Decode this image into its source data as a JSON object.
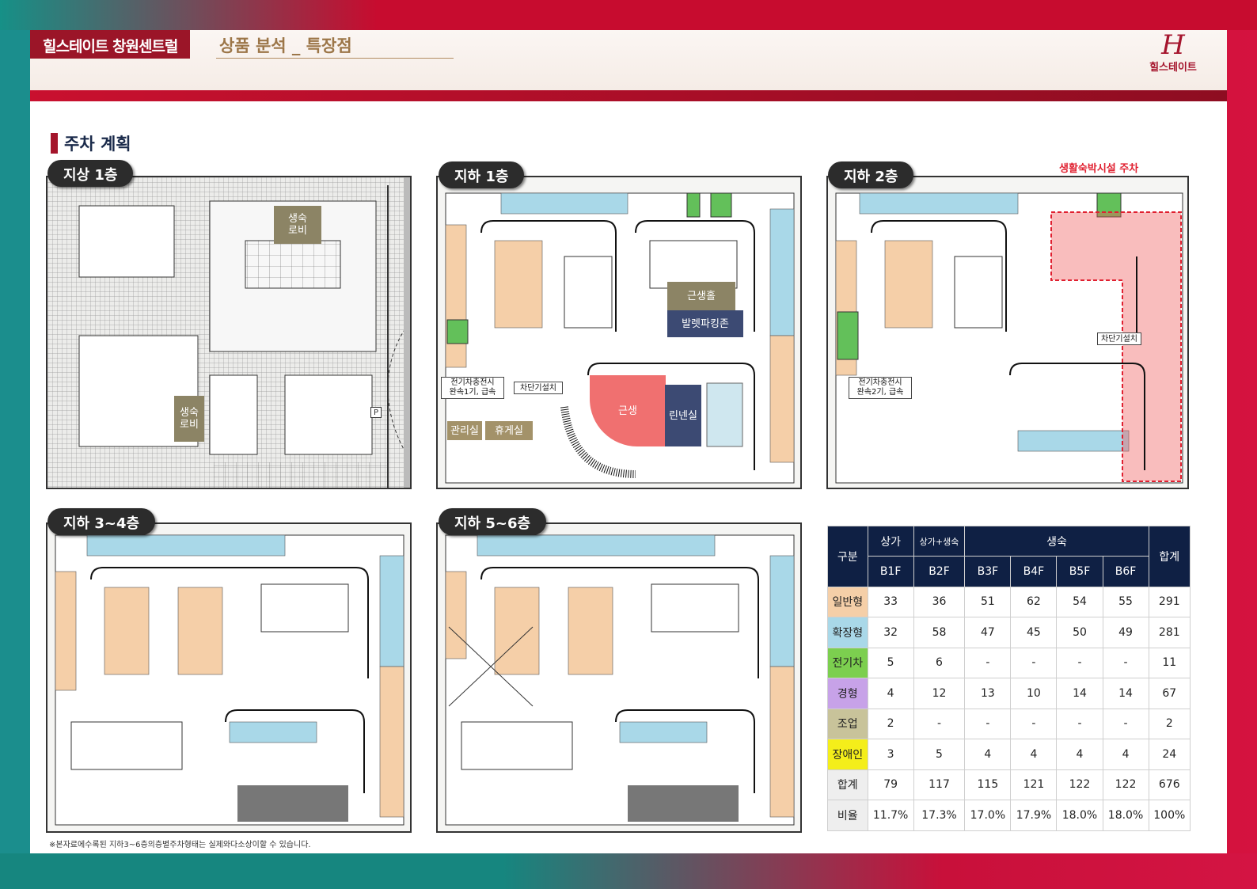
{
  "header": {
    "brand": "힐스테이트 창원센트럴",
    "subtitle": "상품 분석 _ 특장점",
    "logo_text": "힐스테이트",
    "logo_mark": "H"
  },
  "section_title": "주차 계획",
  "plans": {
    "ground": {
      "label": "지상 1층",
      "rooms": [
        "생숙\n로비",
        "생숙\n로비"
      ],
      "sign": "P"
    },
    "b1": {
      "label": "지하 1층",
      "rooms": {
        "retail_hall": "근생홀",
        "valet": "발렛파킹존",
        "retail": "근생",
        "linen": "린넨실",
        "mgmt": "관리실",
        "lounge": "휴게실",
        "ev_charger": "전기차충전시\n완속1기, 급속",
        "breaker": "차단기설치"
      }
    },
    "b2": {
      "label": "지하 2층",
      "annotation": "생활숙박시설 주차",
      "rooms": {
        "ev_charger": "전기차충전시\n완속2기, 급속",
        "breaker": "차단기설치"
      }
    },
    "b34": {
      "label": "지하 3~4층"
    },
    "b56": {
      "label": "지하 5~6층"
    }
  },
  "note": "※본자료에수록된 지하3~6층의층별주차형태는 실제와다소상이할 수 있습니다.",
  "table": {
    "header_group": {
      "category": "구분",
      "retail": "상가",
      "mixed": "상가+생숙",
      "residence": "생숙",
      "total": "합계"
    },
    "floors": [
      "B1F",
      "B2F",
      "B3F",
      "B4F",
      "B5F",
      "B6F"
    ],
    "rows": [
      {
        "name": "일반형",
        "color": "#f5cfa8",
        "values": [
          "33",
          "36",
          "51",
          "62",
          "54",
          "55",
          "291"
        ]
      },
      {
        "name": "확장형",
        "color": "#a9d8e8",
        "values": [
          "32",
          "58",
          "47",
          "45",
          "50",
          "49",
          "281"
        ]
      },
      {
        "name": "전기차",
        "color": "#7ccf4f",
        "values": [
          "5",
          "6",
          "-",
          "-",
          "-",
          "-",
          "11"
        ]
      },
      {
        "name": "경형",
        "color": "#c7a2e8",
        "values": [
          "4",
          "12",
          "13",
          "10",
          "14",
          "14",
          "67"
        ]
      },
      {
        "name": "조업",
        "color": "#c8c39a",
        "values": [
          "2",
          "-",
          "-",
          "-",
          "-",
          "-",
          "2"
        ]
      },
      {
        "name": "장애인",
        "color": "#f4ee1a",
        "values": [
          "3",
          "5",
          "4",
          "4",
          "4",
          "4",
          "24"
        ]
      },
      {
        "name": "합계",
        "color": "#eeeeee",
        "values": [
          "79",
          "117",
          "115",
          "121",
          "122",
          "122",
          "676"
        ]
      },
      {
        "name": "비율",
        "color": "#eeeeee",
        "values": [
          "11.7%",
          "17.3%",
          "17.0%",
          "17.9%",
          "18.0%",
          "18.0%",
          "100%"
        ]
      }
    ]
  }
}
